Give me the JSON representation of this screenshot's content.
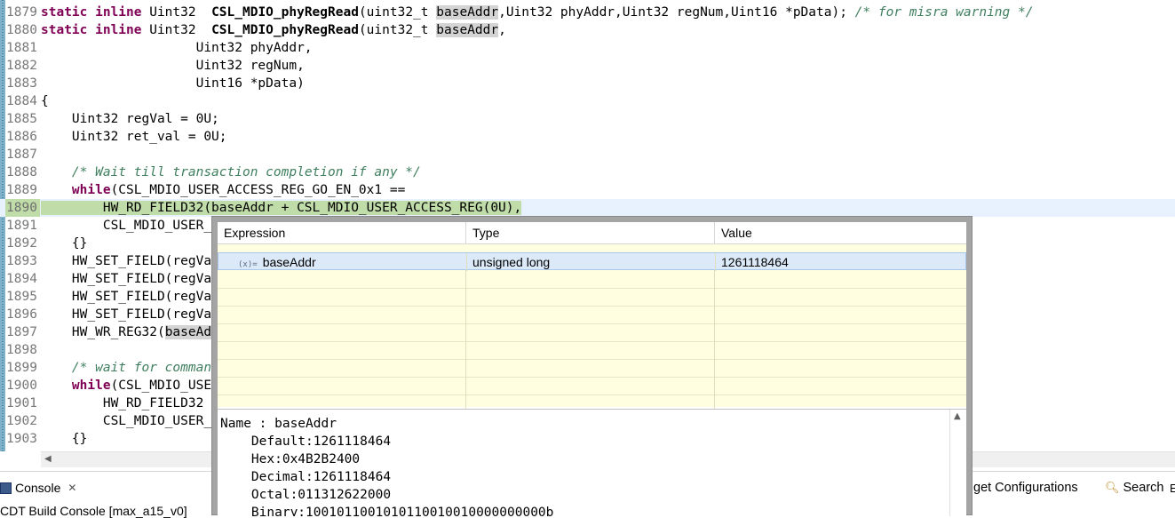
{
  "editor": {
    "lines": [
      {
        "num": "1879",
        "tokens": [
          {
            "t": "static inline ",
            "c": "kw"
          },
          {
            "t": "Uint32  ",
            "c": ""
          },
          {
            "t": "CSL_MDIO_phyRegRead",
            "c": "fn"
          },
          {
            "t": "(uint32_t ",
            "c": ""
          },
          {
            "t": "baseAddr",
            "c": "occ"
          },
          {
            "t": ",Uint32 phyAddr,Uint32 regNum,Uint16 *pData); ",
            "c": ""
          },
          {
            "t": "/* for misra warning */",
            "c": "cm"
          }
        ]
      },
      {
        "num": "1880",
        "tokens": [
          {
            "t": "static inline ",
            "c": "kw"
          },
          {
            "t": "Uint32  ",
            "c": ""
          },
          {
            "t": "CSL_MDIO_phyRegRead",
            "c": "fn"
          },
          {
            "t": "(uint32_t ",
            "c": ""
          },
          {
            "t": "baseAddr",
            "c": "occ"
          },
          {
            "t": ",",
            "c": ""
          }
        ]
      },
      {
        "num": "1881",
        "tokens": [
          {
            "t": "                    Uint32 phyAddr,",
            "c": ""
          }
        ]
      },
      {
        "num": "1882",
        "tokens": [
          {
            "t": "                    Uint32 regNum,",
            "c": ""
          }
        ]
      },
      {
        "num": "1883",
        "tokens": [
          {
            "t": "                    Uint16 *pData)",
            "c": ""
          }
        ]
      },
      {
        "num": "1884",
        "tokens": [
          {
            "t": "{",
            "c": ""
          }
        ]
      },
      {
        "num": "1885",
        "tokens": [
          {
            "t": "    Uint32 regVal = 0U;",
            "c": ""
          }
        ]
      },
      {
        "num": "1886",
        "tokens": [
          {
            "t": "    Uint32 ret_val = 0U;",
            "c": ""
          }
        ]
      },
      {
        "num": "1887",
        "tokens": []
      },
      {
        "num": "1888",
        "tokens": [
          {
            "t": "    ",
            "c": ""
          },
          {
            "t": "/* Wait till transaction completion if any */",
            "c": "cm"
          }
        ]
      },
      {
        "num": "1889",
        "tokens": [
          {
            "t": "    ",
            "c": ""
          },
          {
            "t": "while",
            "c": "kw"
          },
          {
            "t": "(CSL_MDIO_USER_ACCESS_REG_GO_EN_0x1 ==",
            "c": ""
          }
        ]
      },
      {
        "num": "1890",
        "tokens": [
          {
            "t": "        HW_RD_FIELD32(baseAddr + CSL_MDIO_USER_ACCESS_REG(0U),",
            "c": "hl-cur"
          }
        ],
        "current": true
      },
      {
        "num": "1891",
        "tokens": [
          {
            "t": "        CSL_MDIO_USER_",
            "c": ""
          }
        ]
      },
      {
        "num": "1892",
        "tokens": [
          {
            "t": "    {}",
            "c": ""
          }
        ]
      },
      {
        "num": "1893",
        "tokens": [
          {
            "t": "    HW_SET_FIELD(regVa",
            "c": ""
          }
        ]
      },
      {
        "num": "1894",
        "tokens": [
          {
            "t": "    HW_SET_FIELD(regVa",
            "c": ""
          }
        ]
      },
      {
        "num": "1895",
        "tokens": [
          {
            "t": "    HW_SET_FIELD(regVa",
            "c": ""
          }
        ]
      },
      {
        "num": "1896",
        "tokens": [
          {
            "t": "    HW_SET_FIELD(regVa",
            "c": ""
          }
        ]
      },
      {
        "num": "1897",
        "tokens": [
          {
            "t": "    HW_WR_REG32(",
            "c": ""
          },
          {
            "t": "baseAd",
            "c": "occ"
          }
        ]
      },
      {
        "num": "1898",
        "tokens": []
      },
      {
        "num": "1899",
        "tokens": [
          {
            "t": "    ",
            "c": ""
          },
          {
            "t": "/* wait for comman",
            "c": "cm"
          }
        ]
      },
      {
        "num": "1900",
        "tokens": [
          {
            "t": "    ",
            "c": ""
          },
          {
            "t": "while",
            "c": "kw"
          },
          {
            "t": "(CSL_MDIO_USE",
            "c": ""
          }
        ]
      },
      {
        "num": "1901",
        "tokens": [
          {
            "t": "        HW_RD_FIELD32",
            "c": ""
          }
        ]
      },
      {
        "num": "1902",
        "tokens": [
          {
            "t": "        CSL_MDIO_USER_",
            "c": ""
          }
        ]
      },
      {
        "num": "1903",
        "tokens": [
          {
            "t": "    {}",
            "c": ""
          }
        ]
      }
    ]
  },
  "popup": {
    "headers": {
      "expression": "Expression",
      "type": "Type",
      "value": "Value"
    },
    "row": {
      "icon": "(x)=",
      "expression": "baseAddr",
      "type": "unsigned long",
      "value": "1261118464"
    },
    "detail": [
      "Name : baseAddr",
      "    Default:1261118464",
      "    Hex:0x4B2B2400",
      "    Decimal:1261118464",
      "    Octal:011312622000",
      "    Binary:1001011001010110010010000000000b"
    ]
  },
  "bottom": {
    "console_tab": "Console",
    "console_close": "✕",
    "console_subtitle": "CDT Build Console [max_a15_v0]",
    "targets_tab": "get Configurations",
    "search_tab": "Search"
  },
  "colors": {
    "keyword": "#7f0055",
    "comment": "#3f7f5f",
    "current_line": "#e8f2fe",
    "hover_bg": "#fffee0"
  }
}
